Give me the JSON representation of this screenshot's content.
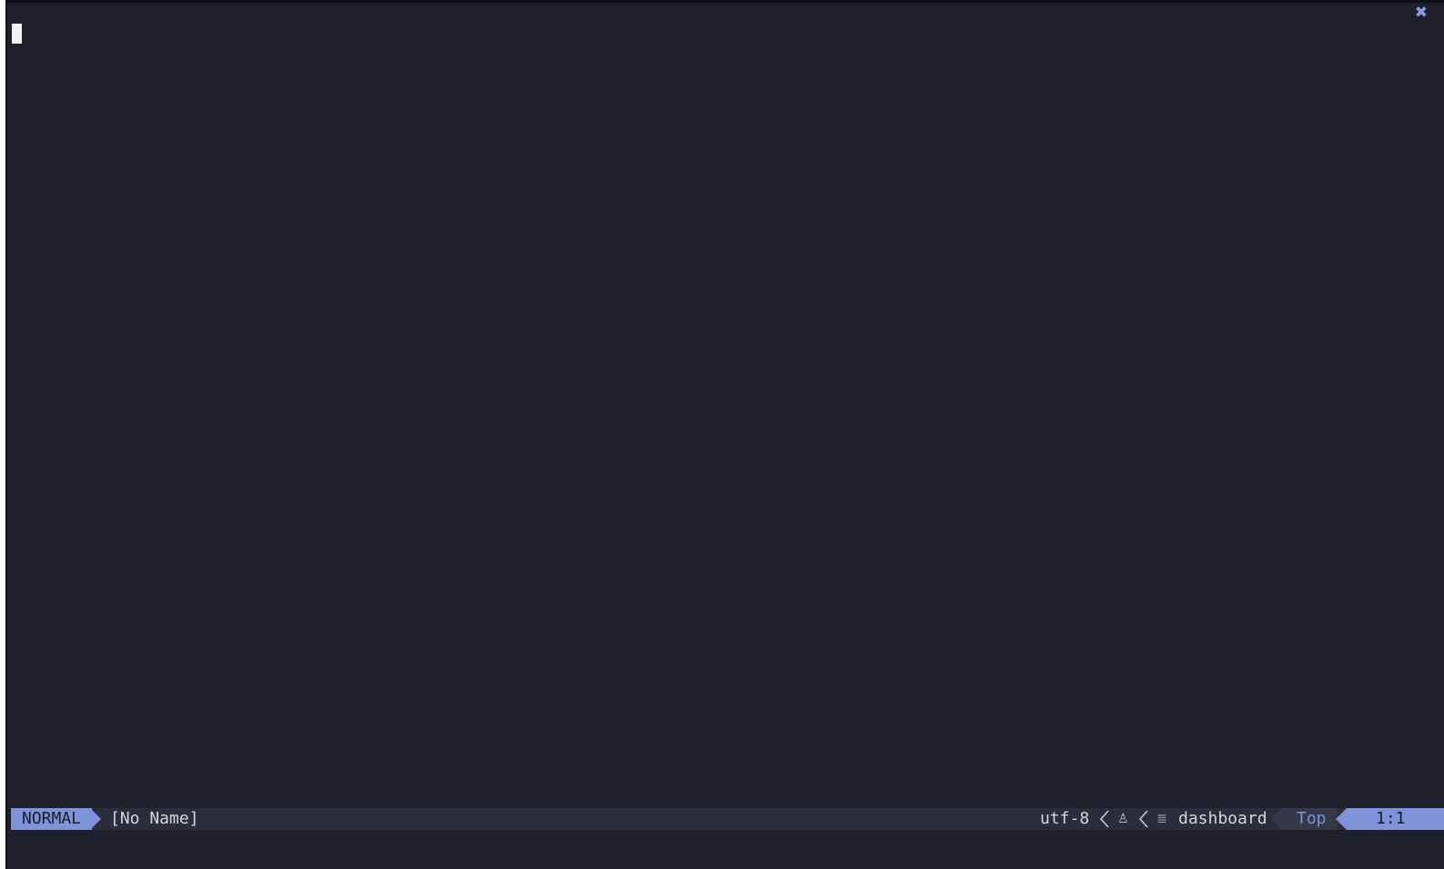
{
  "statusline": {
    "mode": "NORMAL",
    "filename": "[No Name]",
    "encoding": "utf-8",
    "os_icon": "linux-tux-icon",
    "filetype_icon": "text-lines-icon",
    "filetype": "dashboard",
    "progress": "Top",
    "location": "1:1"
  },
  "window": {
    "close_icon": "close-x-icon"
  },
  "colors": {
    "background": "#1f202b",
    "statusline_bg": "#2b2d3b",
    "accent": "#7f94d8",
    "text": "#d6d6dc"
  }
}
